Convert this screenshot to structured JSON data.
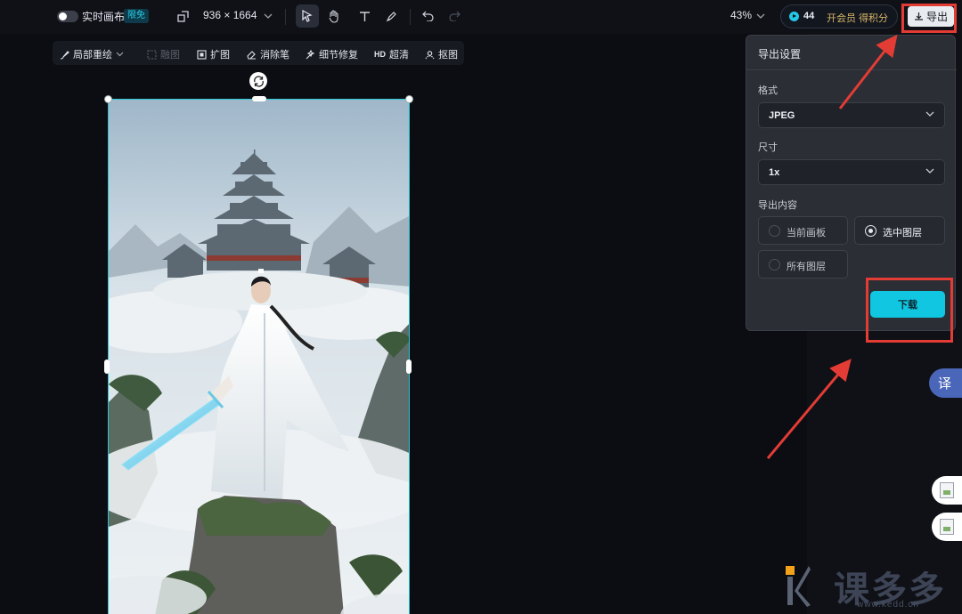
{
  "topbar": {
    "realtime_label": "实时画布",
    "free_badge": "限免",
    "canvas_size": "936 × 1664",
    "zoom": "43%",
    "credits": "44",
    "vip_label": "开会员 得积分",
    "export_label": "导出"
  },
  "subbar": {
    "items": [
      {
        "label": "局部重绘",
        "icon": "brush-icon",
        "enabled": true
      },
      {
        "label": "融图",
        "icon": "merge-icon",
        "enabled": false
      },
      {
        "label": "扩图",
        "icon": "expand-icon",
        "enabled": true
      },
      {
        "label": "消除笔",
        "icon": "eraser-icon",
        "enabled": true
      },
      {
        "label": "细节修复",
        "icon": "repair-icon",
        "enabled": true
      },
      {
        "label": "超清",
        "icon": "hd-icon",
        "prefix": "HD",
        "enabled": true
      },
      {
        "label": "抠图",
        "icon": "cutout-icon",
        "enabled": true
      }
    ]
  },
  "panel": {
    "title": "导出设置",
    "format_label": "格式",
    "format_value": "JPEG",
    "size_label": "尺寸",
    "size_value": "1x",
    "content_label": "导出内容",
    "options": [
      {
        "label": "当前画板",
        "selected": false
      },
      {
        "label": "选中图层",
        "selected": true
      },
      {
        "label": "所有图层",
        "selected": false
      }
    ],
    "download_label": "下载"
  },
  "side": {
    "translate_label": "译"
  },
  "watermark": {
    "text": "课多多",
    "url": "www.kedd.cn"
  },
  "colors": {
    "accent": "#10c6e0",
    "annotation": "#e23c35",
    "background": "#0b0d12"
  }
}
